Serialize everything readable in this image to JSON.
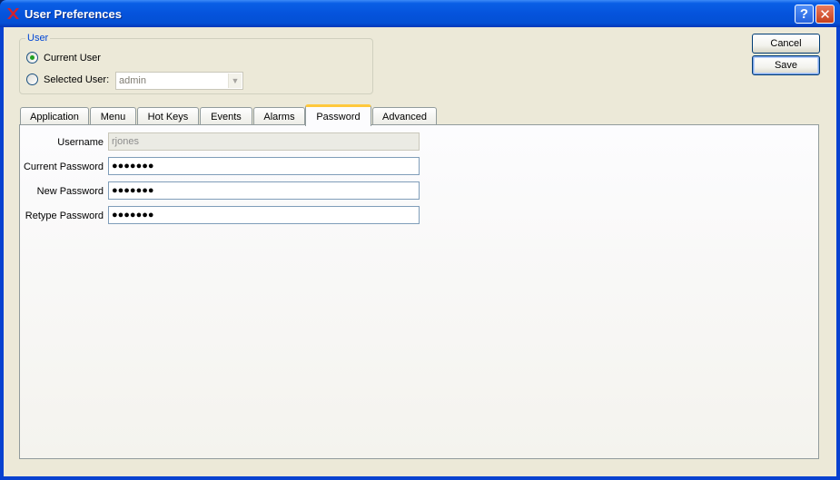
{
  "window": {
    "title": "User Preferences",
    "help_glyph": "?",
    "close_glyph": "✕"
  },
  "user_group": {
    "legend": "User",
    "current_user_label": "Current User",
    "selected_user_label": "Selected User:",
    "selected_user_value": "admin",
    "current_user_checked": true
  },
  "actions": {
    "cancel_label": "Cancel",
    "save_label": "Save"
  },
  "tabs": [
    {
      "label": "Application"
    },
    {
      "label": "Menu"
    },
    {
      "label": "Hot Keys"
    },
    {
      "label": "Events"
    },
    {
      "label": "Alarms"
    },
    {
      "label": "Password",
      "active": true
    },
    {
      "label": "Advanced"
    }
  ],
  "password_form": {
    "username_label": "Username",
    "username_value": "rjones",
    "current_password_label": "Current Password",
    "current_password_value": "●●●●●●●",
    "new_password_label": "New Password",
    "new_password_value": "●●●●●●●",
    "retype_password_label": "Retype Password",
    "retype_password_value": "●●●●●●●"
  },
  "colors": {
    "titlebar": "#0553dc",
    "client_bg": "#ece9d8",
    "group_legend": "#0046d5",
    "active_tab_accent": "#ffc83c"
  },
  "icons": {
    "app": "xtuple-x-icon",
    "help": "help-icon",
    "close": "close-icon",
    "dropdown": "chevron-down-icon"
  }
}
